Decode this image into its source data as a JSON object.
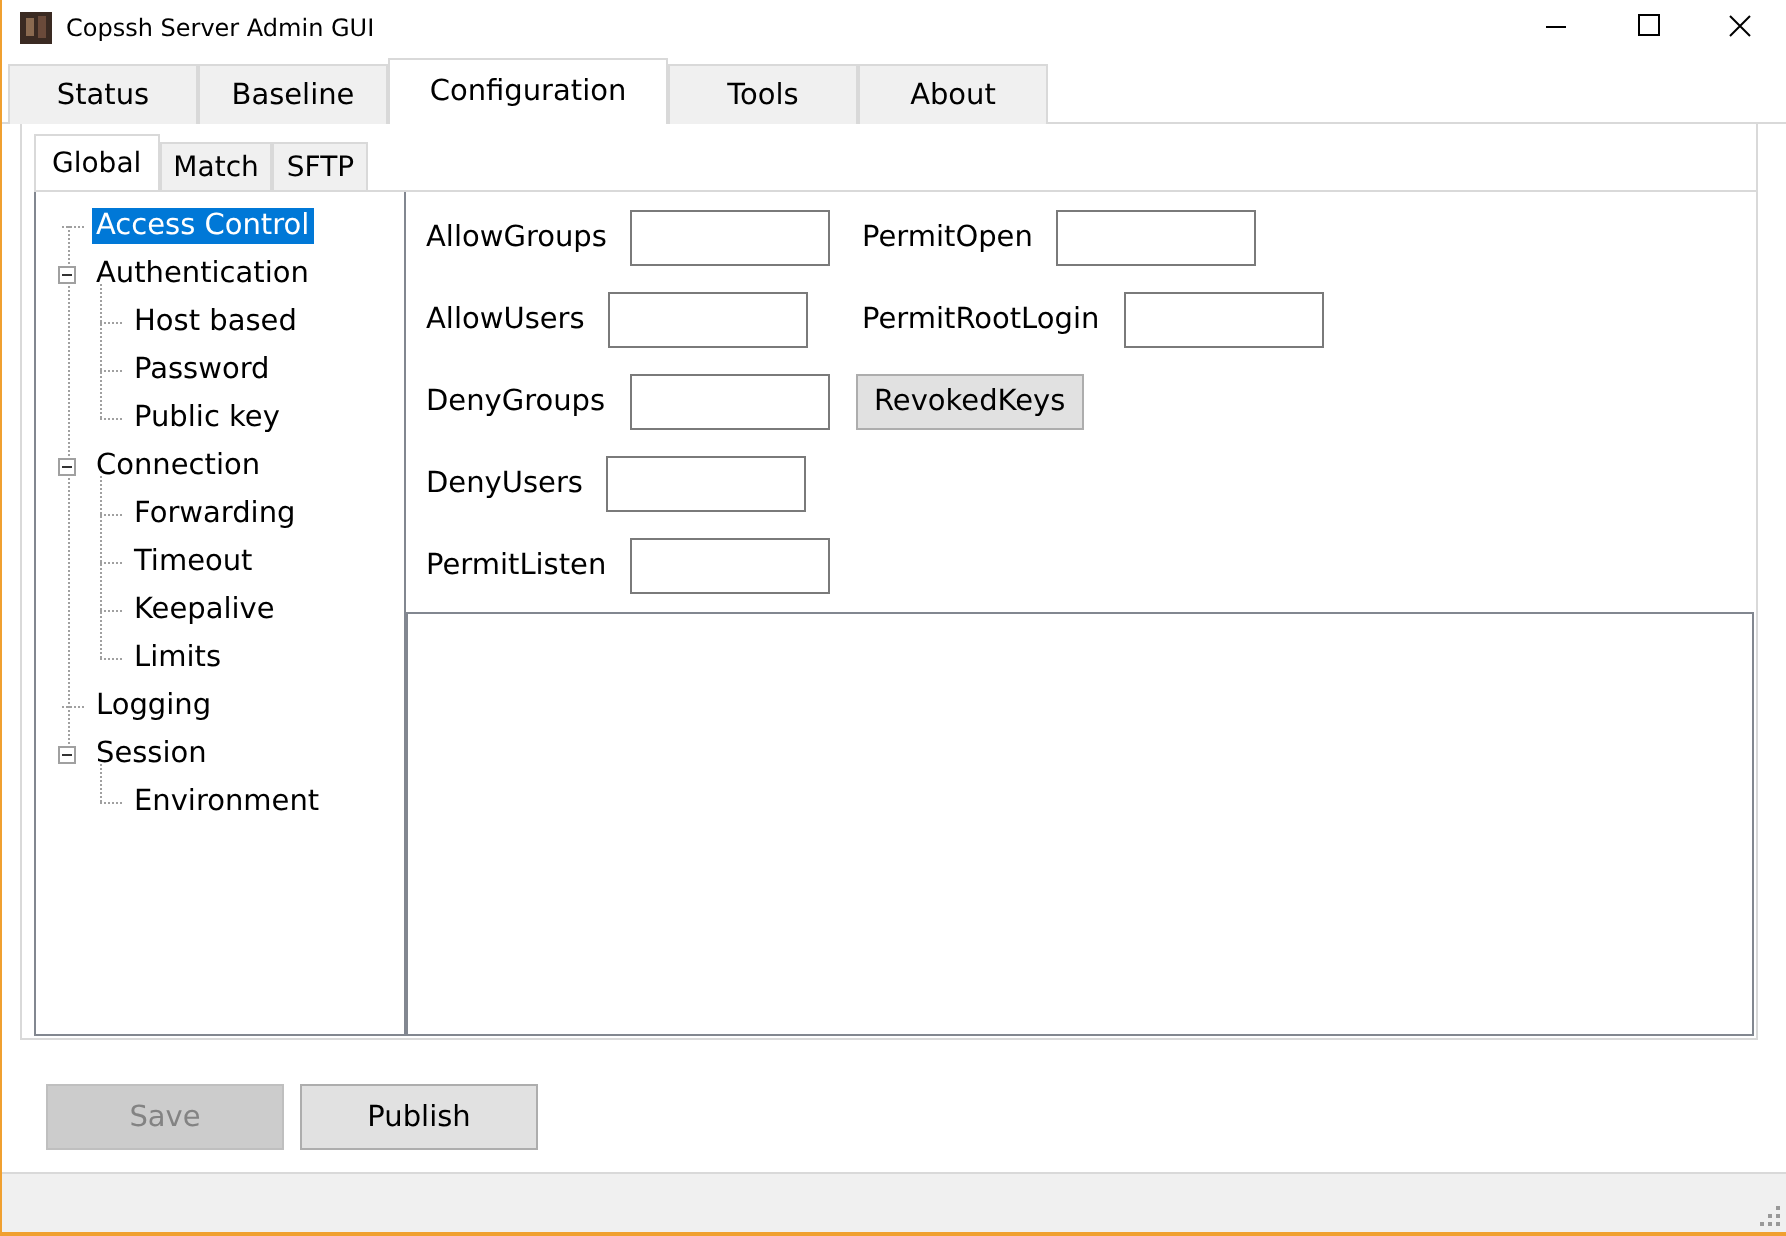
{
  "window": {
    "title": "Copssh Server Admin GUI"
  },
  "tabs": [
    {
      "label": "Status",
      "selected": false
    },
    {
      "label": "Baseline",
      "selected": false
    },
    {
      "label": "Configuration",
      "selected": true
    },
    {
      "label": "Tools",
      "selected": false
    },
    {
      "label": "About",
      "selected": false
    }
  ],
  "subtabs": [
    {
      "label": "Global",
      "selected": true
    },
    {
      "label": "Match",
      "selected": false
    },
    {
      "label": "SFTP",
      "selected": false
    }
  ],
  "tree": [
    {
      "label": "Access Control",
      "selected": true
    },
    {
      "label": "Authentication",
      "selected": false,
      "expanded": true,
      "children": [
        {
          "label": "Host based",
          "selected": false
        },
        {
          "label": "Password",
          "selected": false
        },
        {
          "label": "Public key",
          "selected": false
        }
      ]
    },
    {
      "label": "Connection",
      "selected": false,
      "expanded": true,
      "children": [
        {
          "label": "Forwarding",
          "selected": false
        },
        {
          "label": "Timeout",
          "selected": false
        },
        {
          "label": "Keepalive",
          "selected": false
        },
        {
          "label": "Limits",
          "selected": false
        }
      ]
    },
    {
      "label": "Logging",
      "selected": false
    },
    {
      "label": "Session",
      "selected": false,
      "expanded": true,
      "children": [
        {
          "label": "Environment",
          "selected": false
        }
      ]
    }
  ],
  "fields_left": [
    {
      "label": "AllowGroups"
    },
    {
      "label": "AllowUsers"
    },
    {
      "label": "DenyGroups"
    },
    {
      "label": "DenyUsers"
    },
    {
      "label": "PermitListen"
    }
  ],
  "fields_right": [
    {
      "kind": "field",
      "label": "PermitOpen"
    },
    {
      "kind": "field",
      "label": "PermitRootLogin"
    },
    {
      "kind": "button",
      "label": "RevokedKeys"
    }
  ],
  "buttons": [
    {
      "label": "Save",
      "disabled": true
    },
    {
      "label": "Publish",
      "disabled": false
    }
  ]
}
